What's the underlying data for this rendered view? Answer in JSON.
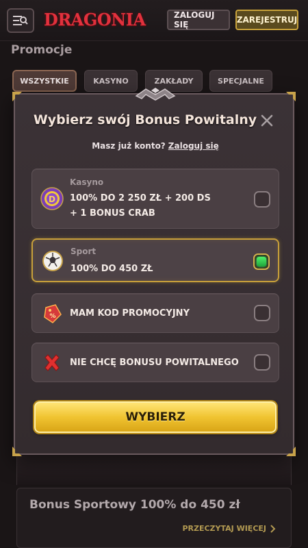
{
  "header": {
    "logo_text": "DRAGONIA",
    "login_label": "ZALOGUJ SIĘ",
    "register_label": "ZAREJESTRUJ"
  },
  "page": {
    "title": "Promocje",
    "tabs": [
      {
        "label": "WSZYSTKIE",
        "active": true
      },
      {
        "label": "KASYNO",
        "active": false
      },
      {
        "label": "ZAKŁADY",
        "active": false
      },
      {
        "label": "SPECJALNE",
        "active": false
      }
    ],
    "promo_card": {
      "title": "Bonus Sportowy 100% do 450 zł",
      "link_label": "PRZECZYTAJ WIĘCEJ"
    }
  },
  "modal": {
    "title": "Wybierz swój Bonus Powitalny",
    "login_prompt": "Masz już konto?",
    "login_link": "Zaloguj się",
    "options": [
      {
        "icon": "casino-chip-icon",
        "category": "Kasyno",
        "line1": "100% DO 2 250 ZŁ + 200 DS",
        "line2": "+ 1 BONUS CRAB",
        "selected": false
      },
      {
        "icon": "football-icon",
        "category": "Sport",
        "line1": "100% DO 450 ZŁ",
        "selected": true
      },
      {
        "icon": "promo-tag-icon",
        "label": "MAM KOD PROMOCYJNY",
        "selected": false
      },
      {
        "icon": "red-x-icon",
        "label": "NIE CHCĘ BONUSU POWITALNEGO",
        "selected": false
      }
    ],
    "choose_label": "WYBIERZ"
  },
  "colors": {
    "accent_gold": "#f0c431",
    "selected_green": "#3ee05c",
    "brand_red": "#e2313d"
  }
}
